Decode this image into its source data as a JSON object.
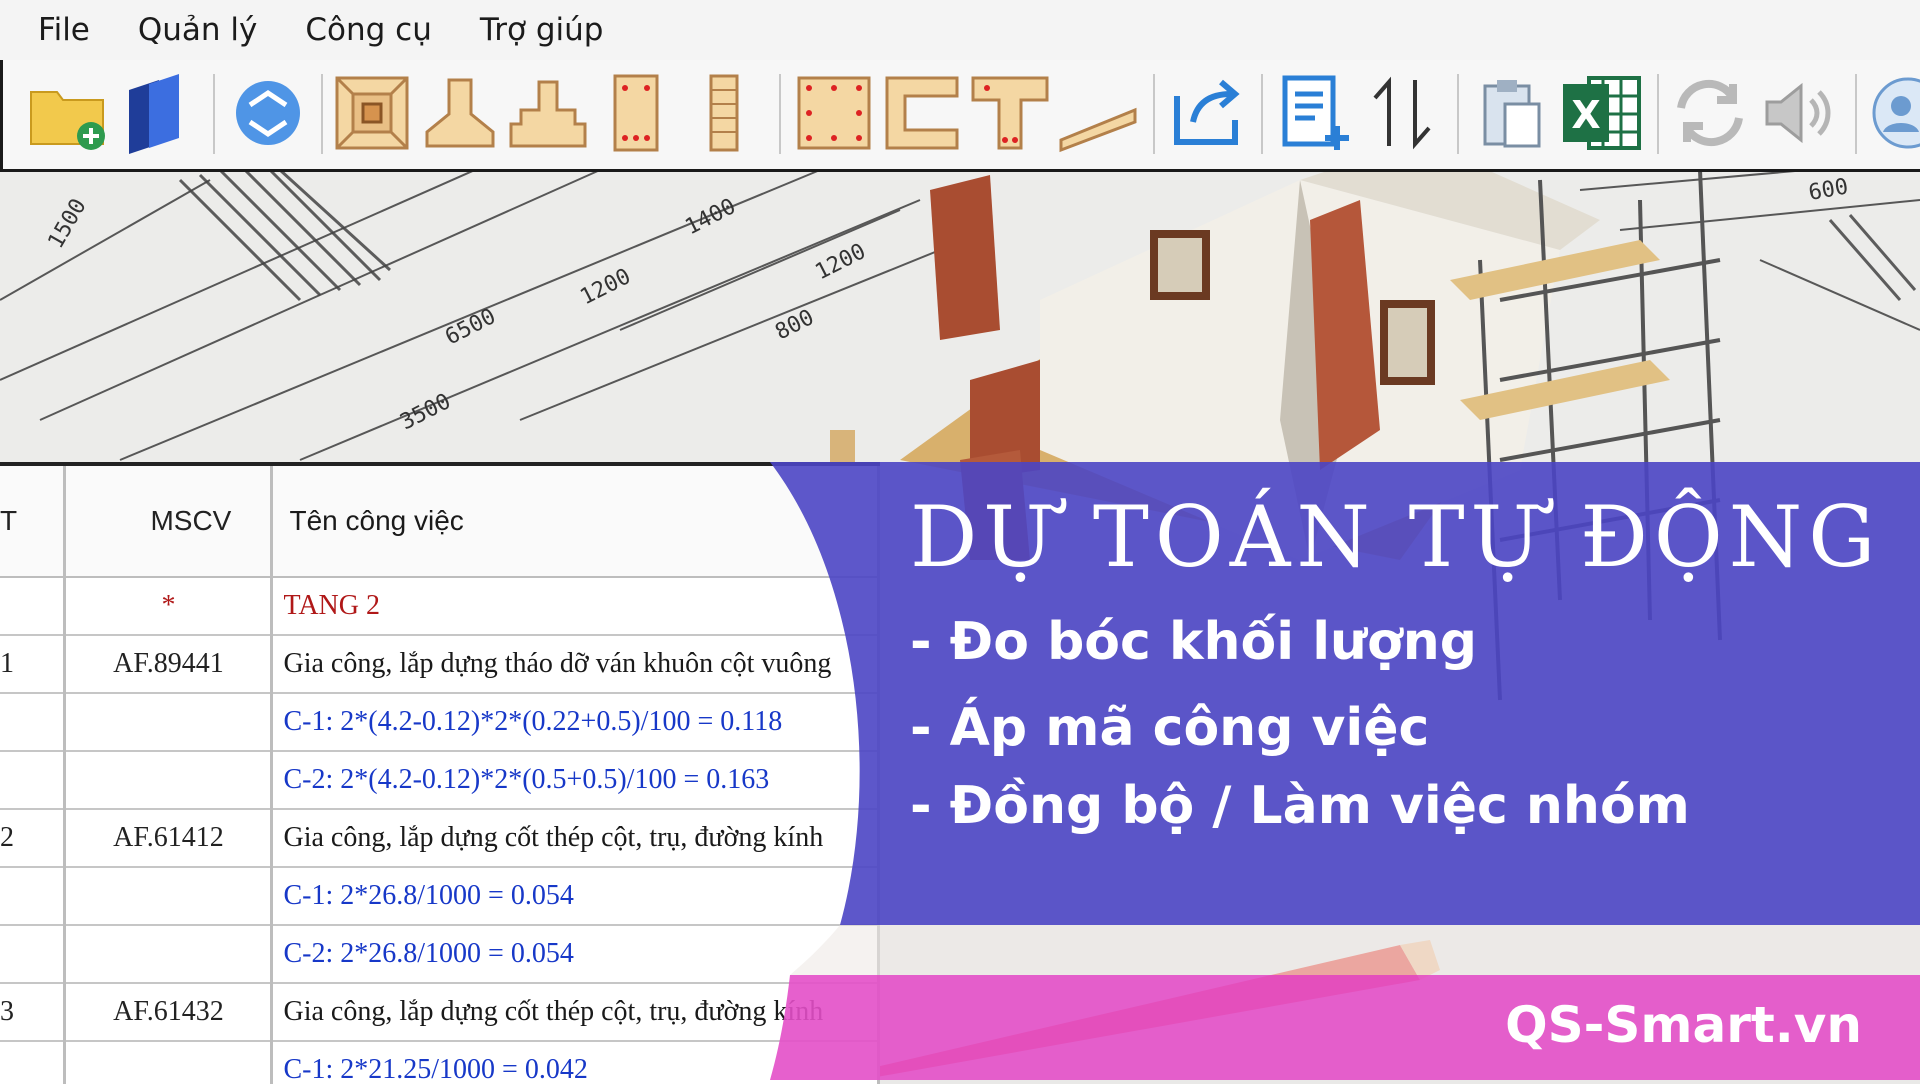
{
  "menu": [
    "File",
    "Quản lý",
    "Công cụ",
    "Trợ giúp"
  ],
  "toolbar_icons": [
    "new-project-icon",
    "layers-icon",
    "sync-globe-icon",
    "rectangular-pit-icon",
    "pad-footing-icon",
    "stepped-footing-icon",
    "column-rebar-icon",
    "brick-column-icon",
    "beam-section-icon",
    "channel-section-icon",
    "t-beam-section-icon",
    "ramp-icon",
    "export-icon",
    "add-list-icon",
    "sort-icon",
    "clipboard-icon",
    "excel-icon",
    "refresh-icon",
    "speaker-icon",
    "user-settings-icon"
  ],
  "table": {
    "headers": {
      "stt": "T",
      "mscv": "MSCV",
      "ten": "Tên công việc"
    },
    "rows": [
      {
        "stt": "",
        "mscv": "*",
        "ten": "TANG 2",
        "style": "red"
      },
      {
        "stt": "1",
        "mscv": "AF.89441",
        "ten": "Gia công, lắp dựng tháo dỡ ván khuôn cột vuông",
        "style": "dark"
      },
      {
        "stt": "",
        "mscv": "",
        "ten": "C-1: 2*(4.2-0.12)*2*(0.22+0.5)/100 = 0.118",
        "style": "blue"
      },
      {
        "stt": "",
        "mscv": "",
        "ten": "C-2: 2*(4.2-0.12)*2*(0.5+0.5)/100 = 0.163",
        "style": "blue"
      },
      {
        "stt": "2",
        "mscv": "AF.61412",
        "ten": "Gia công, lắp dựng cốt thép cột, trụ, đường kính",
        "style": "dark"
      },
      {
        "stt": "",
        "mscv": "",
        "ten": "C-1: 2*26.8/1000 = 0.054",
        "style": "blue"
      },
      {
        "stt": "",
        "mscv": "",
        "ten": "C-2: 2*26.8/1000 = 0.054",
        "style": "blue"
      },
      {
        "stt": "3",
        "mscv": "AF.61432",
        "ten": "Gia công, lắp dựng cốt thép cột, trụ, đường kính",
        "style": "dark"
      },
      {
        "stt": "",
        "mscv": "",
        "ten": "C-1: 2*21.25/1000 = 0.042",
        "style": "blue"
      }
    ]
  },
  "banner": {
    "headline": "DỰ TOÁN TỰ ĐỘNG",
    "bullets": [
      "- Đo bóc khối lượng",
      "- Áp mã công việc",
      "- Đồng bộ / Làm việc nhóm"
    ],
    "brand": "QS-Smart.vn"
  },
  "drawing_labels": [
    "6500",
    "3500",
    "1200",
    "1400",
    "1200",
    "1500",
    "800",
    "600"
  ],
  "colors": {
    "banner_blue": "#4b45c4",
    "banner_pink": "#e34fc8",
    "table_blue_text": "#1738c8",
    "table_red_text": "#b01818"
  }
}
